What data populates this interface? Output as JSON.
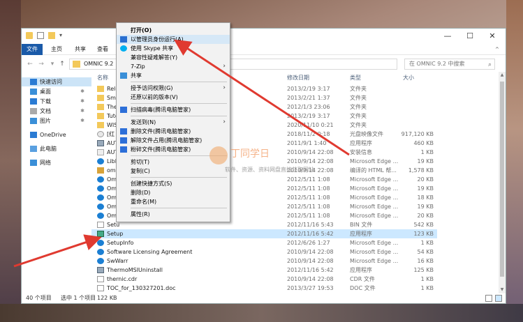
{
  "window": {
    "ribbon_tabs": [
      "文件",
      "主页",
      "共享",
      "查看"
    ],
    "path": "OMNIC 9.2",
    "search_placeholder": "在 OMNIC 9.2 中搜索",
    "controls": [
      "—",
      "☐",
      "✕",
      "^"
    ]
  },
  "nav": {
    "items": [
      {
        "label": "快速访问",
        "selected": true
      },
      {
        "label": "桌面",
        "pinned": true
      },
      {
        "label": "下载",
        "pinned": true
      },
      {
        "label": "文档",
        "pinned": true
      },
      {
        "label": "图片",
        "pinned": true
      },
      {
        "label": "OneDrive"
      },
      {
        "label": "此电脑"
      },
      {
        "label": "网络"
      }
    ],
    "pin_glyph": "✱"
  },
  "columns": {
    "name": "名称",
    "date": "修改日期",
    "type": "类型",
    "size": "大小"
  },
  "files": [
    {
      "name": "Rele",
      "date": "2013/2/19 3:17",
      "type": "文件夹",
      "size": "",
      "icon": "folder"
    },
    {
      "name": "Sma",
      "date": "2013/2/21 1:37",
      "type": "文件夹",
      "size": "",
      "icon": "folder"
    },
    {
      "name": "The",
      "date": "2012/1/3 23:06",
      "type": "文件夹",
      "size": "",
      "icon": "folder"
    },
    {
      "name": "Tuto",
      "date": "2013/2/19 3:17",
      "type": "文件夹",
      "size": "",
      "icon": "folder"
    },
    {
      "name": "WIS",
      "date": "2020/11/10 0:21",
      "type": "文件夹",
      "size": "",
      "icon": "folder"
    },
    {
      "name": "[红",
      "date": "2018/11/2 0:18",
      "type": "光盘映像文件",
      "size": "917,120 KB",
      "icon": "disc"
    },
    {
      "name": "AUT",
      "date": "2011/9/1 1:40",
      "type": "应用程序",
      "size": "460 KB",
      "icon": "app"
    },
    {
      "name": "AUT",
      "date": "2010/9/14 22:08",
      "type": "安装信息",
      "size": "1 KB",
      "icon": "inf"
    },
    {
      "name": "Libl",
      "date": "2010/9/14 22:08",
      "type": "Microsoft Edge ...",
      "size": "19 KB",
      "icon": "edge"
    },
    {
      "name": "omi",
      "date": "2010/9/14 22:08",
      "type": "编译的 HTML 帮...",
      "size": "1,578 KB",
      "icon": "help"
    },
    {
      "name": "Omi",
      "date": "2012/5/11 1:08",
      "type": "Microsoft Edge ...",
      "size": "20 KB",
      "icon": "edge"
    },
    {
      "name": "Omi",
      "date": "2012/5/11 1:08",
      "type": "Microsoft Edge ...",
      "size": "19 KB",
      "icon": "edge"
    },
    {
      "name": "Omi",
      "date": "2012/5/11 1:08",
      "type": "Microsoft Edge ...",
      "size": "18 KB",
      "icon": "edge"
    },
    {
      "name": "Omi",
      "date": "2012/5/11 1:08",
      "type": "Microsoft Edge ...",
      "size": "19 KB",
      "icon": "edge"
    },
    {
      "name": "Omi",
      "date": "2012/5/11 1:08",
      "type": "Microsoft Edge ...",
      "size": "20 KB",
      "icon": "edge"
    },
    {
      "name": "Setu",
      "date": "2012/11/16 5:43",
      "type": "BIN 文件",
      "size": "542 KB",
      "icon": "file"
    },
    {
      "name": "Setup",
      "date": "2012/11/16 5:42",
      "type": "应用程序",
      "size": "123 KB",
      "icon": "setup",
      "selected": true
    },
    {
      "name": "SetupInfo",
      "date": "2012/6/26 1:27",
      "type": "Microsoft Edge ...",
      "size": "1 KB",
      "icon": "edge"
    },
    {
      "name": "Software Licensing Agreement",
      "date": "2010/9/14 22:08",
      "type": "Microsoft Edge ...",
      "size": "54 KB",
      "icon": "edge"
    },
    {
      "name": "SwWarr",
      "date": "2010/9/14 22:08",
      "type": "Microsoft Edge ...",
      "size": "16 KB",
      "icon": "edge"
    },
    {
      "name": "ThermoMSIUninstall",
      "date": "2012/11/16 5:42",
      "type": "应用程序",
      "size": "125 KB",
      "icon": "app"
    },
    {
      "name": "thernic.cdr",
      "date": "2010/9/14 22:08",
      "type": "CDR 文件",
      "size": "1 KB",
      "icon": "file"
    },
    {
      "name": "TOC_for_130327201.doc",
      "date": "2013/3/27 19:53",
      "type": "DOC 文件",
      "size": "1 KB",
      "icon": "file"
    }
  ],
  "status": {
    "count": "40 个项目",
    "selected": "选中 1 个项目",
    "size": "122 KB"
  },
  "context_menu": {
    "items": [
      {
        "label": "打开(O)",
        "bold": true
      },
      {
        "label": "以管理员身份运行(A)",
        "icon": "shield",
        "highlight": true
      },
      {
        "label": "使用 Skype 共享",
        "icon": "skype"
      },
      {
        "label": "兼容性疑难解答(Y)"
      },
      {
        "label": "7-Zip",
        "submenu": true
      },
      {
        "label": "共享",
        "icon": "share"
      },
      {
        "label": "授予访问权限(G)",
        "submenu": true,
        "sep_before": true
      },
      {
        "label": "还原以前的版本(V)"
      },
      {
        "label": "扫描病毒(腾讯电脑管家)",
        "icon": "guard",
        "sep_before": true
      },
      {
        "label": "发送到(N)",
        "submenu": true,
        "sep_before": true
      },
      {
        "label": "删除文件(腾讯电脑管家)",
        "icon": "guard"
      },
      {
        "label": "解除文件占用(腾讯电脑管家)",
        "icon": "guard"
      },
      {
        "label": "粉碎文件(腾讯电脑管家)",
        "icon": "guard"
      },
      {
        "label": "剪切(T)",
        "sep_before": true
      },
      {
        "label": "复制(C)"
      },
      {
        "label": "创建快捷方式(S)",
        "sep_before": true
      },
      {
        "label": "删除(D)"
      },
      {
        "label": "重命名(M)"
      },
      {
        "label": "属性(R)",
        "sep_before": true
      }
    ],
    "arrow_glyph": "›"
  },
  "watermark": {
    "title": "丁同学日",
    "subtitle": "软件、资源、资料网盘直接获取网站"
  },
  "colors": {
    "accent": "#1a5aa8",
    "folder": "#f3c95a",
    "edge": "#1b7fd3",
    "arrow": "#e03a30",
    "selection": "#cce8ff"
  }
}
